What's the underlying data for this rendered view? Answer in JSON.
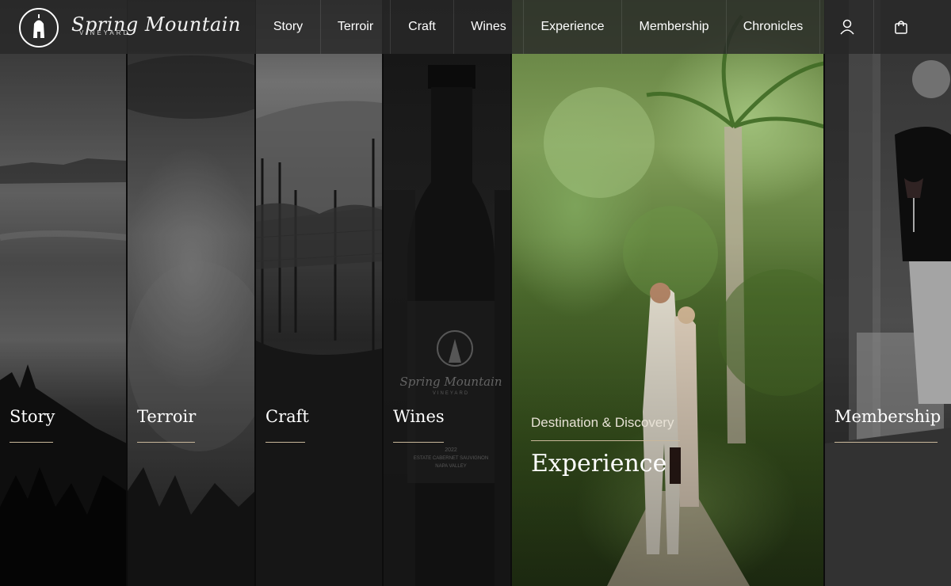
{
  "brand": {
    "name": "Spring Mountain",
    "sub": "VINEYARD"
  },
  "nav": {
    "items": [
      "Story",
      "Terroir",
      "Craft",
      "Wines",
      "Experience",
      "Membership",
      "Chronicles"
    ],
    "account_icon": "user-icon",
    "cart_icon": "shopping-bag-icon"
  },
  "panels": {
    "story": {
      "label": "Story"
    },
    "terroir": {
      "label": "Terroir"
    },
    "craft": {
      "label": "Craft"
    },
    "wines": {
      "label": "Wines",
      "bottle_brand": "Spring Mountain",
      "bottle_sub": "VINEYARD",
      "bottle_year": "2022",
      "bottle_varietal": "ESTATE CABERNET SAUVIGNON",
      "bottle_region": "NAPA VALLEY"
    },
    "experience": {
      "kicker": "Destination & Discovery",
      "title": "Experience"
    },
    "membership": {
      "label": "Membership"
    }
  },
  "colors": {
    "accent_underline": "#c8b79a",
    "header_bg": "#282828"
  }
}
